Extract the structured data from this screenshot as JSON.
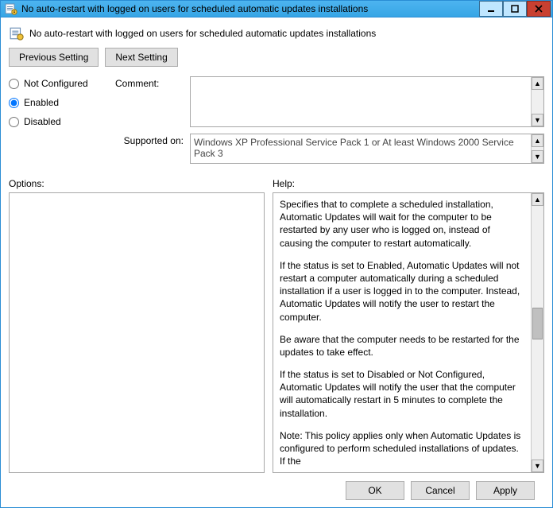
{
  "window": {
    "title": "No auto-restart with logged on users for scheduled automatic updates installations"
  },
  "policy": {
    "name": "No auto-restart with logged on users for scheduled automatic updates installations"
  },
  "nav": {
    "prev_label": "Previous Setting",
    "next_label": "Next Setting"
  },
  "state": {
    "not_configured_label": "Not Configured",
    "enabled_label": "Enabled",
    "disabled_label": "Disabled",
    "selected": "enabled"
  },
  "labels": {
    "comment": "Comment:",
    "supported_on": "Supported on:",
    "options": "Options:",
    "help": "Help:"
  },
  "comment_value": "",
  "supported_on_value": "Windows XP Professional Service Pack 1 or At least Windows 2000 Service Pack 3",
  "help_paragraphs": {
    "p1": "Specifies that to complete a scheduled installation, Automatic Updates will wait for the computer to be restarted by any user who is logged on, instead of causing the computer to restart automatically.",
    "p2": "If the status is set to Enabled, Automatic Updates will not restart a computer automatically during a scheduled installation if a user is logged in to the computer. Instead, Automatic Updates will notify the user to restart the computer.",
    "p3": "Be aware that the computer needs to be restarted for the updates to take effect.",
    "p4": "If the status is set to Disabled or Not Configured, Automatic Updates will notify the user that the computer will automatically restart in 5 minutes to complete the installation.",
    "p5": "Note: This policy applies only when Automatic Updates is configured to perform scheduled installations of updates. If the"
  },
  "footer": {
    "ok": "OK",
    "cancel": "Cancel",
    "apply": "Apply"
  }
}
